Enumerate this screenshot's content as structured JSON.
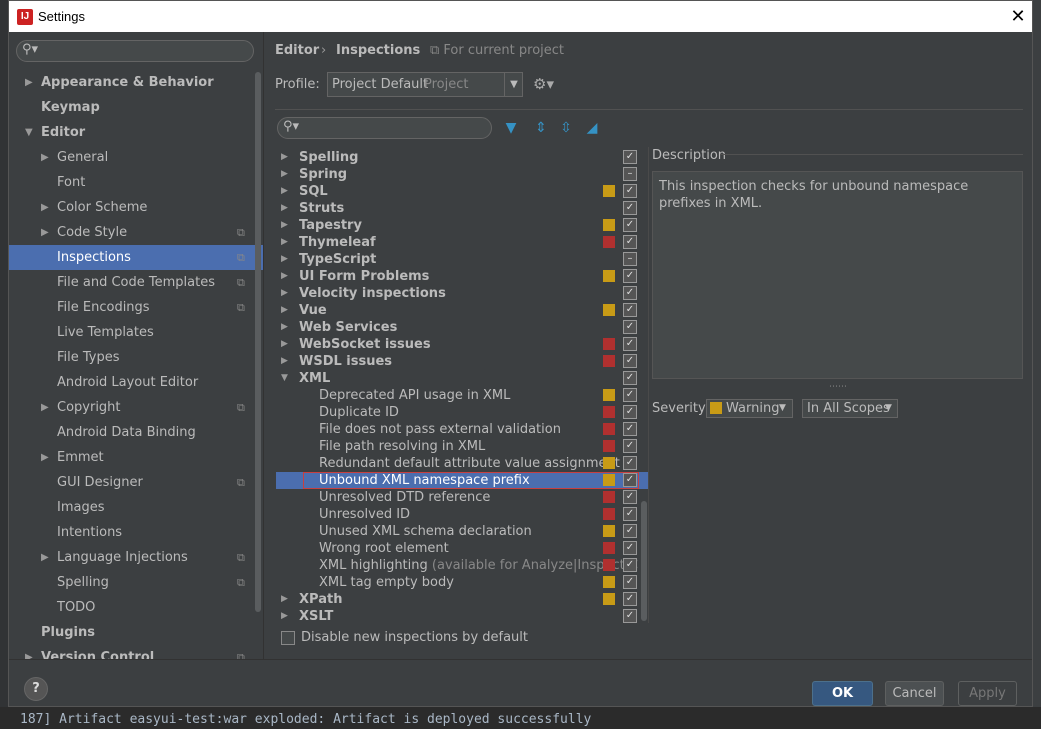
{
  "window": {
    "title": "Settings",
    "close_glyph": "✕",
    "app_icon_text": "IJ"
  },
  "background": {
    "console_text": "187] Artifact easyui-test:war exploded: Artifact is deployed successfully"
  },
  "left_tree": {
    "search_placeholder": "",
    "items": [
      {
        "label": "Appearance & Behavior",
        "level": 0,
        "bold": true,
        "arrow": "right",
        "project_icon": false
      },
      {
        "label": "Keymap",
        "level": 0,
        "bold": true,
        "arrow": "",
        "project_icon": false
      },
      {
        "label": "Editor",
        "level": 0,
        "bold": true,
        "arrow": "down",
        "project_icon": false
      },
      {
        "label": "General",
        "level": 1,
        "bold": false,
        "arrow": "right",
        "project_icon": false
      },
      {
        "label": "Font",
        "level": 1,
        "bold": false,
        "arrow": "",
        "project_icon": false
      },
      {
        "label": "Color Scheme",
        "level": 1,
        "bold": false,
        "arrow": "right",
        "project_icon": false
      },
      {
        "label": "Code Style",
        "level": 1,
        "bold": false,
        "arrow": "right",
        "project_icon": true
      },
      {
        "label": "Inspections",
        "level": 1,
        "bold": false,
        "arrow": "",
        "project_icon": true,
        "selected": true
      },
      {
        "label": "File and Code Templates",
        "level": 1,
        "bold": false,
        "arrow": "",
        "project_icon": true
      },
      {
        "label": "File Encodings",
        "level": 1,
        "bold": false,
        "arrow": "",
        "project_icon": true
      },
      {
        "label": "Live Templates",
        "level": 1,
        "bold": false,
        "arrow": "",
        "project_icon": false
      },
      {
        "label": "File Types",
        "level": 1,
        "bold": false,
        "arrow": "",
        "project_icon": false
      },
      {
        "label": "Android Layout Editor",
        "level": 1,
        "bold": false,
        "arrow": "",
        "project_icon": false
      },
      {
        "label": "Copyright",
        "level": 1,
        "bold": false,
        "arrow": "right",
        "project_icon": true
      },
      {
        "label": "Android Data Binding",
        "level": 1,
        "bold": false,
        "arrow": "",
        "project_icon": false
      },
      {
        "label": "Emmet",
        "level": 1,
        "bold": false,
        "arrow": "right",
        "project_icon": false
      },
      {
        "label": "GUI Designer",
        "level": 1,
        "bold": false,
        "arrow": "",
        "project_icon": true
      },
      {
        "label": "Images",
        "level": 1,
        "bold": false,
        "arrow": "",
        "project_icon": false
      },
      {
        "label": "Intentions",
        "level": 1,
        "bold": false,
        "arrow": "",
        "project_icon": false
      },
      {
        "label": "Language Injections",
        "level": 1,
        "bold": false,
        "arrow": "right",
        "project_icon": true
      },
      {
        "label": "Spelling",
        "level": 1,
        "bold": false,
        "arrow": "",
        "project_icon": true
      },
      {
        "label": "TODO",
        "level": 1,
        "bold": false,
        "arrow": "",
        "project_icon": false
      },
      {
        "label": "Plugins",
        "level": 0,
        "bold": true,
        "arrow": "",
        "project_icon": false
      },
      {
        "label": "Version Control",
        "level": 0,
        "bold": true,
        "arrow": "right",
        "project_icon": true
      }
    ]
  },
  "breadcrumb": {
    "part1": "Editor",
    "separator": "›",
    "part2": "Inspections",
    "scope_note": "For current project"
  },
  "profile": {
    "label": "Profile:",
    "value": "Project Default",
    "scope": "Project",
    "arrow": "▼"
  },
  "inspections": {
    "search_placeholder": "",
    "rows": [
      {
        "label": "Spelling",
        "group": true,
        "arrow": "right",
        "severity": "none",
        "check": "checked"
      },
      {
        "label": "Spring",
        "group": true,
        "arrow": "right",
        "severity": "none",
        "check": "partial"
      },
      {
        "label": "SQL",
        "group": true,
        "arrow": "right",
        "severity": "warning",
        "check": "checked"
      },
      {
        "label": "Struts",
        "group": true,
        "arrow": "right",
        "severity": "none",
        "check": "checked"
      },
      {
        "label": "Tapestry",
        "group": true,
        "arrow": "right",
        "severity": "warning",
        "check": "checked"
      },
      {
        "label": "Thymeleaf",
        "group": true,
        "arrow": "right",
        "severity": "error",
        "check": "checked"
      },
      {
        "label": "TypeScript",
        "group": true,
        "arrow": "right",
        "severity": "none",
        "check": "partial"
      },
      {
        "label": "UI Form Problems",
        "group": true,
        "arrow": "right",
        "severity": "warning",
        "check": "checked"
      },
      {
        "label": "Velocity inspections",
        "group": true,
        "arrow": "right",
        "severity": "none",
        "check": "checked"
      },
      {
        "label": "Vue",
        "group": true,
        "arrow": "right",
        "severity": "warning",
        "check": "checked"
      },
      {
        "label": "Web Services",
        "group": true,
        "arrow": "right",
        "severity": "none",
        "check": "checked"
      },
      {
        "label": "WebSocket issues",
        "group": true,
        "arrow": "right",
        "severity": "error",
        "check": "checked"
      },
      {
        "label": "WSDL issues",
        "group": true,
        "arrow": "right",
        "severity": "error",
        "check": "checked"
      },
      {
        "label": "XML",
        "group": true,
        "arrow": "down",
        "severity": "none",
        "check": "checked"
      },
      {
        "label": "Deprecated API usage in XML",
        "group": false,
        "arrow": "",
        "severity": "warning",
        "check": "checked"
      },
      {
        "label": "Duplicate ID",
        "group": false,
        "arrow": "",
        "severity": "error",
        "check": "checked"
      },
      {
        "label": "File does not pass external validation",
        "group": false,
        "arrow": "",
        "severity": "error",
        "check": "checked"
      },
      {
        "label": "File path resolving in XML",
        "group": false,
        "arrow": "",
        "severity": "error",
        "check": "checked"
      },
      {
        "label": "Redundant default attribute value assignment",
        "group": false,
        "arrow": "",
        "severity": "warning",
        "check": "checked"
      },
      {
        "label": "Unbound XML namespace prefix",
        "group": false,
        "arrow": "",
        "severity": "warning",
        "check": "checked",
        "selected": true
      },
      {
        "label": "Unresolved DTD reference",
        "group": false,
        "arrow": "",
        "severity": "error",
        "check": "checked"
      },
      {
        "label": "Unresolved ID",
        "group": false,
        "arrow": "",
        "severity": "error",
        "check": "checked"
      },
      {
        "label": "Unused XML schema declaration",
        "group": false,
        "arrow": "",
        "severity": "warning",
        "check": "checked"
      },
      {
        "label": "Wrong root element",
        "group": false,
        "arrow": "",
        "severity": "error",
        "check": "checked"
      },
      {
        "label": "XML highlighting",
        "note": "(available for Analyze|Inspect C",
        "group": false,
        "arrow": "",
        "severity": "error",
        "check": "checked"
      },
      {
        "label": "XML tag empty body",
        "group": false,
        "arrow": "",
        "severity": "warning",
        "check": "checked"
      },
      {
        "label": "XPath",
        "group": true,
        "arrow": "right",
        "severity": "warning",
        "check": "checked"
      },
      {
        "label": "XSLT",
        "group": true,
        "arrow": "right",
        "severity": "none",
        "check": "checked"
      }
    ]
  },
  "description": {
    "title": "Description",
    "text": "This inspection checks for unbound namespace prefixes in XML."
  },
  "severity": {
    "label": "Severity:",
    "value": "Warning",
    "scope": "In All Scopes"
  },
  "disable_new": {
    "label": "Disable new inspections by default"
  },
  "buttons": {
    "help": "?",
    "ok": "OK",
    "cancel": "Cancel",
    "apply": "Apply"
  },
  "colors": {
    "accent": "#4b6eaf",
    "warning": "#c89b16",
    "error": "#b0302f",
    "selection_outline": "#c74040"
  }
}
